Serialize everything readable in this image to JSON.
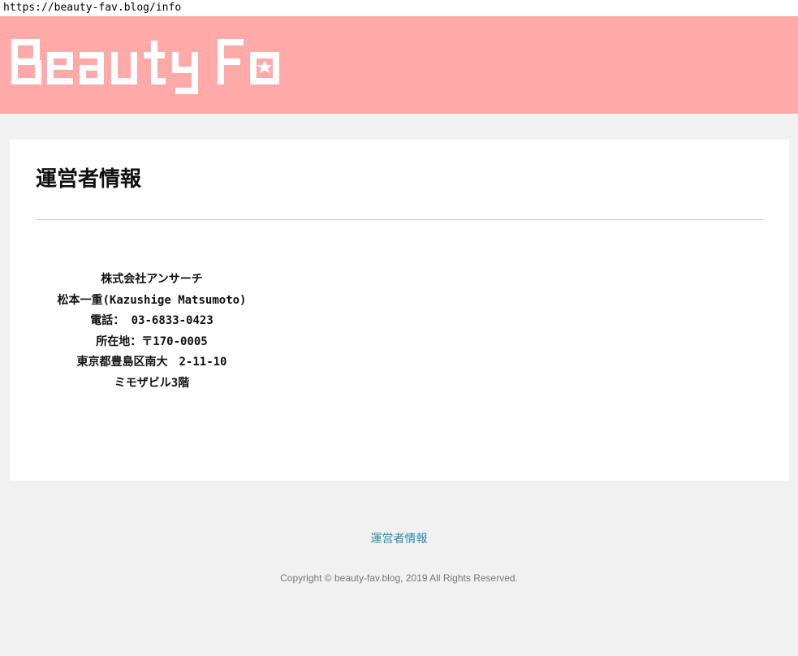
{
  "browser": {
    "url": "https://beauty-fav.blog/info"
  },
  "header": {
    "logo_text": "Beauty Fav",
    "background_color": "#ffa9a9",
    "logo_color": "#ffffff"
  },
  "main": {
    "title": "運営者情報",
    "info_lines": [
      "株式会社アンサーチ",
      "松本一重(Kazushige Matsumoto)",
      "電話： 03-6833-0423",
      "所在地：〒170-0005",
      "東京都豊島区南大　2-11-10",
      "ミモザビル3階"
    ]
  },
  "footer": {
    "link_label": "運営者情報",
    "copyright": "Copyright © beauty-fav.blog, 2019 All Rights Reserved.",
    "link_color": "#2a8aa6"
  }
}
